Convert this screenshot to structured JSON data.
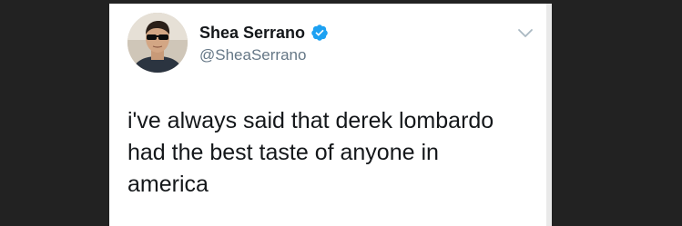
{
  "tweet": {
    "display_name": "Shea Serrano",
    "handle": "@SheaSerrano",
    "verified": true,
    "text_lines": [
      "i've always said that derek lombardo",
      "had the best taste of anyone in",
      "america"
    ]
  },
  "icons": {
    "verified": "verified-badge-icon",
    "menu": "chevron-down-icon"
  },
  "colors": {
    "background": "#222222",
    "card": "#ffffff",
    "verified_blue": "#1da1f2",
    "handle_gray": "#657786",
    "text": "#14171a"
  }
}
